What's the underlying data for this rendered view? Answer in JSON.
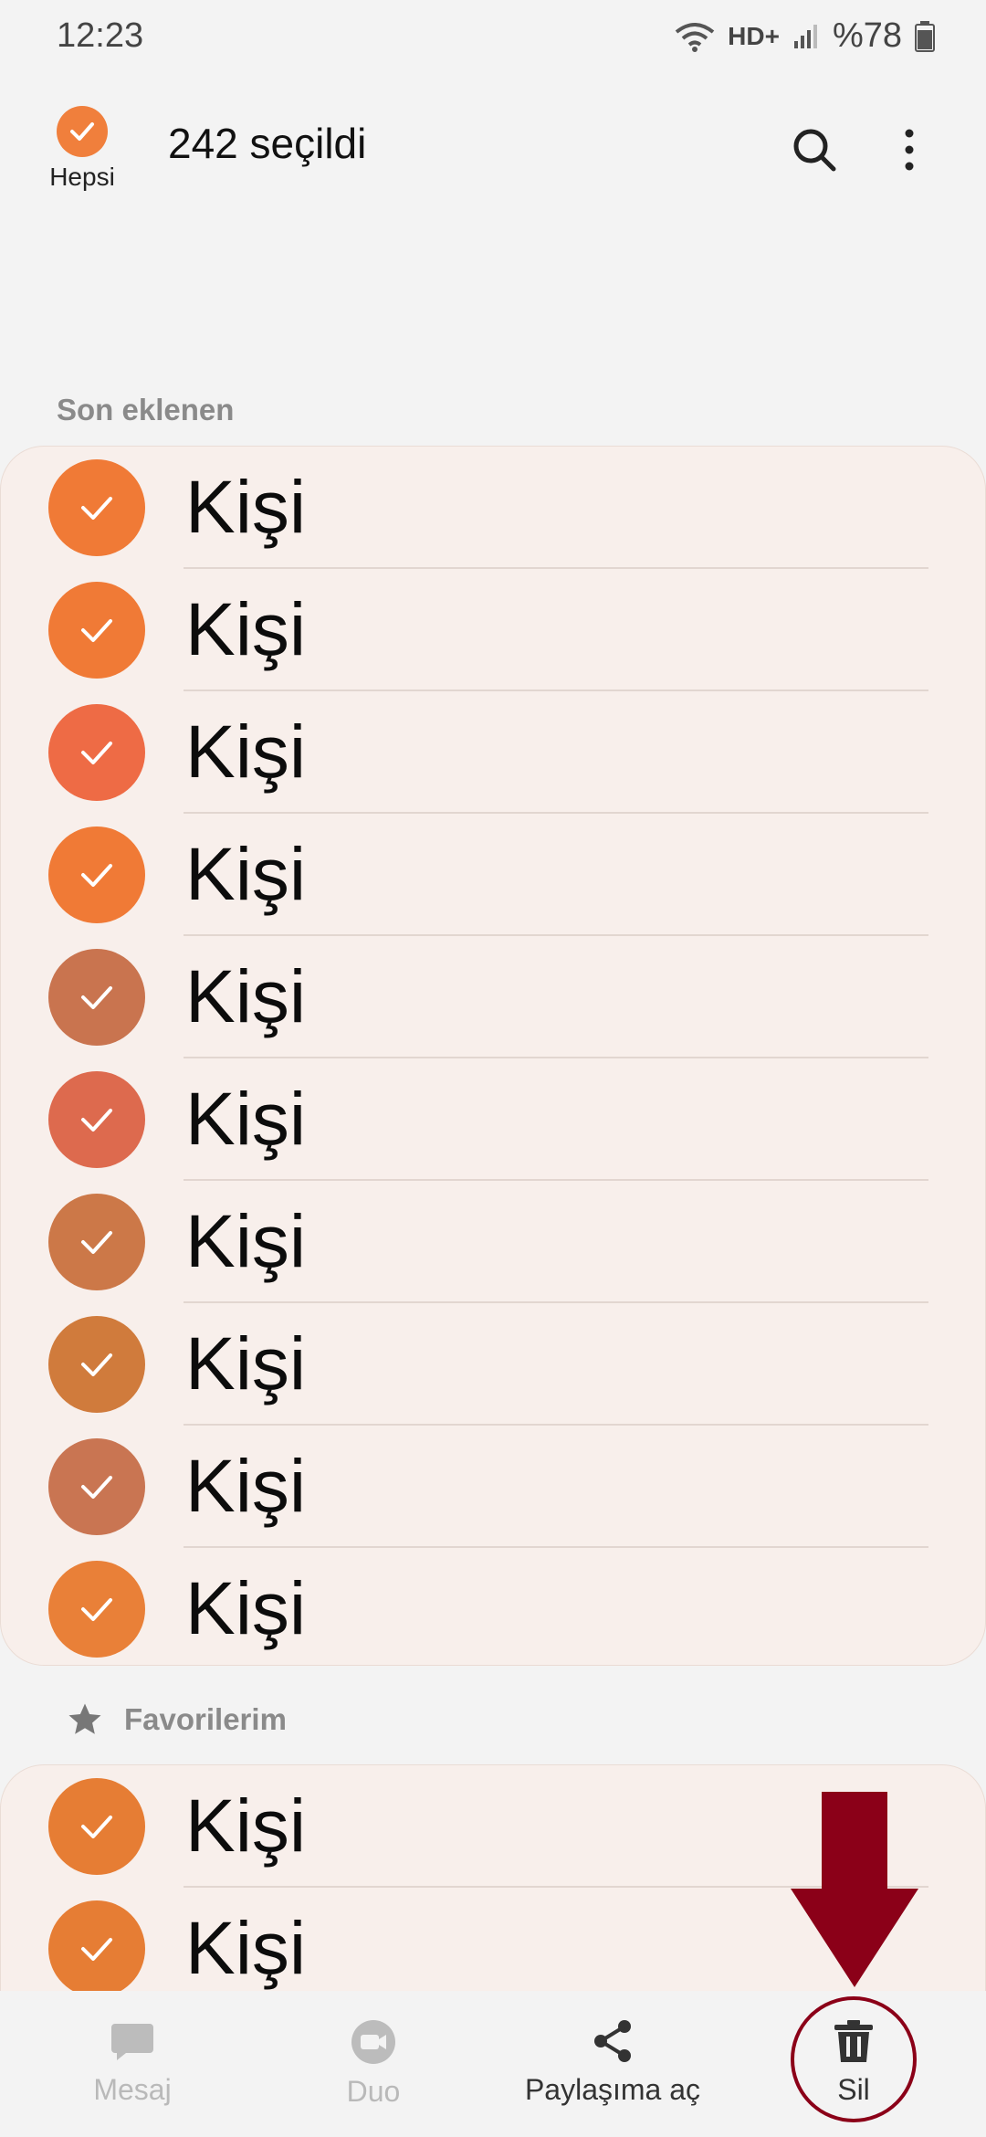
{
  "status_bar": {
    "time": "12:23",
    "network": "HD+",
    "battery": "%78"
  },
  "appbar": {
    "select_all_label": "Hepsi",
    "selected_count": "242 seçildi"
  },
  "sections": {
    "recent_title": "Son eklenen",
    "favorites_title": "Favorilerim"
  },
  "recent_contacts": [
    {
      "name": "Kişi",
      "color": "#f07a36"
    },
    {
      "name": "Kişi",
      "color": "#f07a36"
    },
    {
      "name": "Kişi",
      "color": "#ee6b45"
    },
    {
      "name": "Kişi",
      "color": "#f07a36"
    },
    {
      "name": "Kişi",
      "color": "#c9744f"
    },
    {
      "name": "Kişi",
      "color": "#dd6a4e"
    },
    {
      "name": "Kişi",
      "color": "#cc7848"
    },
    {
      "name": "Kişi",
      "color": "#d07b3c"
    },
    {
      "name": "Kişi",
      "color": "#c97552"
    },
    {
      "name": "Kişi",
      "color": "#e98038"
    }
  ],
  "favorite_contacts": [
    {
      "name": "Kişi",
      "color": "#e67d34"
    },
    {
      "name": "Kişi",
      "color": "#e67d34"
    }
  ],
  "bottom_bar": {
    "message": "Mesaj",
    "duo": "Duo",
    "share": "Paylaşıma aç",
    "delete": "Sil"
  },
  "colors": {
    "accent": "#f07f3c",
    "annotation": "#8b0018",
    "card_bg": "#f8efeb"
  }
}
